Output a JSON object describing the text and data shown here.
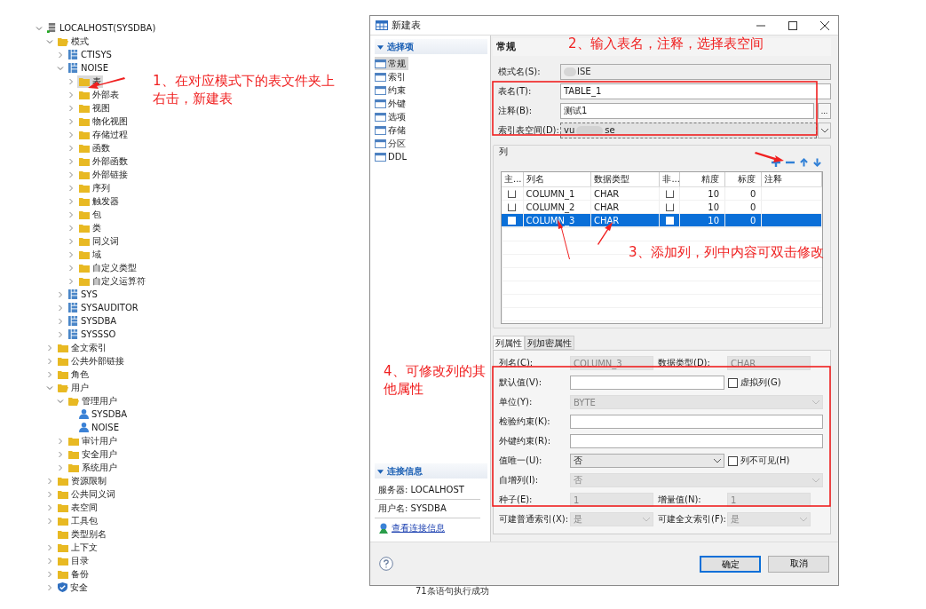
{
  "tree": [
    {
      "label": "LOCALHOST(SYSDBA)",
      "kind": "server",
      "toggle": true,
      "expanded": true,
      "selected": false,
      "children": [
        {
          "label": "模式",
          "kind": "folder",
          "toggle": true,
          "expanded": true,
          "selected": false,
          "children": [
            {
              "label": "CTISYS",
              "kind": "schema",
              "toggle": true,
              "expanded": false,
              "selected": false
            },
            {
              "label": "NOISE",
              "kind": "schema",
              "toggle": true,
              "expanded": true,
              "selected": false,
              "children": [
                {
                  "label": "表",
                  "kind": "folder",
                  "toggle": true,
                  "expanded": false,
                  "selected": true
                },
                {
                  "label": "外部表",
                  "kind": "folder",
                  "toggle": true,
                  "expanded": false,
                  "selected": false
                },
                {
                  "label": "视图",
                  "kind": "folder",
                  "toggle": true,
                  "expanded": false,
                  "selected": false
                },
                {
                  "label": "物化视图",
                  "kind": "folder",
                  "toggle": true,
                  "expanded": false,
                  "selected": false
                },
                {
                  "label": "存储过程",
                  "kind": "folder",
                  "toggle": true,
                  "expanded": false,
                  "selected": false
                },
                {
                  "label": "函数",
                  "kind": "folder",
                  "toggle": true,
                  "expanded": false,
                  "selected": false
                },
                {
                  "label": "外部函数",
                  "kind": "folder",
                  "toggle": true,
                  "expanded": false,
                  "selected": false
                },
                {
                  "label": "外部链接",
                  "kind": "folder",
                  "toggle": true,
                  "expanded": false,
                  "selected": false
                },
                {
                  "label": "序列",
                  "kind": "folder",
                  "toggle": true,
                  "expanded": false,
                  "selected": false
                },
                {
                  "label": "触发器",
                  "kind": "folder",
                  "toggle": true,
                  "expanded": false,
                  "selected": false
                },
                {
                  "label": "包",
                  "kind": "folder",
                  "toggle": true,
                  "expanded": false,
                  "selected": false
                },
                {
                  "label": "类",
                  "kind": "folder",
                  "toggle": true,
                  "expanded": false,
                  "selected": false
                },
                {
                  "label": "同义词",
                  "kind": "folder",
                  "toggle": true,
                  "expanded": false,
                  "selected": false
                },
                {
                  "label": "域",
                  "kind": "folder",
                  "toggle": true,
                  "expanded": false,
                  "selected": false
                },
                {
                  "label": "自定义类型",
                  "kind": "folder",
                  "toggle": true,
                  "expanded": false,
                  "selected": false
                },
                {
                  "label": "自定义运算符",
                  "kind": "folder",
                  "toggle": true,
                  "expanded": false,
                  "selected": false
                }
              ]
            },
            {
              "label": "SYS",
              "kind": "schema",
              "toggle": true,
              "expanded": false,
              "selected": false
            },
            {
              "label": "SYSAUDITOR",
              "kind": "schema",
              "toggle": true,
              "expanded": false,
              "selected": false
            },
            {
              "label": "SYSDBA",
              "kind": "schema",
              "toggle": true,
              "expanded": false,
              "selected": false
            },
            {
              "label": "SYSSSO",
              "kind": "schema",
              "toggle": true,
              "expanded": false,
              "selected": false
            }
          ]
        },
        {
          "label": "全文索引",
          "kind": "folder",
          "toggle": true,
          "expanded": false,
          "selected": false
        },
        {
          "label": "公共外部链接",
          "kind": "folder",
          "toggle": true,
          "expanded": false,
          "selected": false
        },
        {
          "label": "角色",
          "kind": "folder",
          "toggle": true,
          "expanded": false,
          "selected": false
        },
        {
          "label": "用户",
          "kind": "folder",
          "toggle": true,
          "expanded": true,
          "selected": false,
          "children": [
            {
              "label": "管理用户",
              "kind": "folder",
              "toggle": true,
              "expanded": true,
              "selected": false,
              "children": [
                {
                  "label": "SYSDBA",
                  "kind": "user",
                  "toggle": false,
                  "selected": false
                },
                {
                  "label": "NOISE",
                  "kind": "user",
                  "toggle": false,
                  "selected": false
                }
              ]
            },
            {
              "label": "审计用户",
              "kind": "folder",
              "toggle": true,
              "expanded": false,
              "selected": false
            },
            {
              "label": "安全用户",
              "kind": "folder",
              "toggle": true,
              "expanded": false,
              "selected": false
            },
            {
              "label": "系统用户",
              "kind": "folder",
              "toggle": true,
              "expanded": false,
              "selected": false
            }
          ]
        },
        {
          "label": "资源限制",
          "kind": "folder",
          "toggle": true,
          "expanded": false,
          "selected": false
        },
        {
          "label": "公共同义词",
          "kind": "folder",
          "toggle": true,
          "expanded": false,
          "selected": false
        },
        {
          "label": "表空间",
          "kind": "folder",
          "toggle": true,
          "expanded": false,
          "selected": false
        },
        {
          "label": "工具包",
          "kind": "folder",
          "toggle": true,
          "expanded": false,
          "selected": false
        },
        {
          "label": "类型别名",
          "kind": "folder",
          "toggle": false,
          "expanded": false,
          "selected": false
        },
        {
          "label": "上下文",
          "kind": "folder",
          "toggle": true,
          "expanded": false,
          "selected": false
        },
        {
          "label": "目录",
          "kind": "folder",
          "toggle": true,
          "expanded": false,
          "selected": false
        },
        {
          "label": "备份",
          "kind": "folder",
          "toggle": true,
          "expanded": false,
          "selected": false
        },
        {
          "label": "安全",
          "kind": "security",
          "toggle": true,
          "expanded": false,
          "selected": false
        }
      ]
    }
  ],
  "background_message": "71条语句执行成功",
  "dialog": {
    "title": "新建表",
    "nav": {
      "header": "选择项",
      "items": [
        {
          "label": "常规",
          "selected": true
        },
        {
          "label": "索引",
          "selected": false
        },
        {
          "label": "约束",
          "selected": false
        },
        {
          "label": "外键",
          "selected": false
        },
        {
          "label": "选项",
          "selected": false
        },
        {
          "label": "存储",
          "selected": false
        },
        {
          "label": "分区",
          "selected": false
        },
        {
          "label": "DDL",
          "selected": false
        }
      ]
    },
    "connection": {
      "header": "连接信息",
      "lines": [
        "服务器: LOCALHOST",
        "用户名: SYSDBA"
      ],
      "link": "查看连接信息"
    },
    "section_title": "常规",
    "form": [
      {
        "label": "模式名(S):",
        "value": "ISE",
        "kind": "readonly"
      },
      {
        "label": "表名(T):",
        "value": "TABLE_1",
        "kind": "text"
      },
      {
        "label": "注释(B):",
        "value": "测试1",
        "kind": "browse",
        "button": "..."
      },
      {
        "label": "索引表空间(D):",
        "value": "vu",
        "value_end": "se",
        "kind": "select"
      }
    ],
    "columns_group": {
      "title": "列",
      "table": {
        "columns": [
          "主...",
          "列名",
          "数据类型",
          "非...",
          "精度",
          "标度",
          "注释"
        ],
        "rows": [
          {
            "primary": false,
            "name": "COLUMN_1",
            "type": "CHAR",
            "not_null": false,
            "precision": "10",
            "scale": "0",
            "selected": false
          },
          {
            "primary": false,
            "name": "COLUMN_2",
            "type": "CHAR",
            "not_null": false,
            "precision": "10",
            "scale": "0",
            "selected": false
          },
          {
            "primary": false,
            "name": "COLUMN_3",
            "type": "CHAR",
            "not_null": false,
            "precision": "10",
            "scale": "0",
            "selected": true
          }
        ]
      }
    },
    "property_tabs": [
      {
        "label": "列属性",
        "selected": true
      },
      {
        "label": "列加密属性",
        "selected": false
      }
    ],
    "properties": [
      {
        "kind": "pair",
        "fields": [
          {
            "label": "列名(C):",
            "value": "COLUMN_3",
            "kind": "text",
            "disabled": true
          },
          {
            "label": "数据类型(D):",
            "value": "CHAR",
            "kind": "text",
            "disabled": true
          }
        ]
      },
      {
        "kind": "single",
        "fields": [
          {
            "label": "默认值(V):",
            "kind": "text",
            "disabled": false
          }
        ],
        "checkbox": {
          "label": "虚拟列(G)",
          "checked": false
        }
      },
      {
        "kind": "single",
        "fields": [
          {
            "label": "单位(Y):",
            "value": "BYTE",
            "kind": "select",
            "disabled": true
          }
        ]
      },
      {
        "kind": "single",
        "fields": [
          {
            "label": "检验约束(K):",
            "kind": "text",
            "disabled": false
          }
        ]
      },
      {
        "kind": "single",
        "fields": [
          {
            "label": "外键约束(R):",
            "kind": "text",
            "disabled": false
          }
        ]
      },
      {
        "kind": "single",
        "fields": [
          {
            "label": "值唯一(U):",
            "value": "否",
            "kind": "select",
            "disabled": false
          }
        ],
        "checkbox": {
          "label": "列不可见(H)",
          "checked": false
        }
      },
      {
        "kind": "single",
        "fields": [
          {
            "label": "自增列(I):",
            "value": "否",
            "kind": "select",
            "disabled": true
          }
        ]
      },
      {
        "kind": "pair",
        "fields": [
          {
            "label": "种子(E):",
            "value": "1",
            "kind": "text",
            "disabled": true
          },
          {
            "label": "增量值(N):",
            "value": "1",
            "kind": "text",
            "disabled": true
          }
        ]
      },
      {
        "kind": "pair",
        "fields": [
          {
            "label": "可建普通索引(X):",
            "value": "是",
            "kind": "select",
            "disabled": true
          },
          {
            "label": "可建全文索引(F):",
            "value": "是",
            "kind": "select",
            "disabled": true
          }
        ]
      }
    ],
    "buttons": [
      {
        "label": "确定",
        "default": true
      },
      {
        "label": "取消",
        "default": false
      }
    ]
  },
  "annotations": [
    "1、在对应模式下的表文件夹上右击，新建表",
    "2、输入表名，注释，选择表空间",
    "3、添加列，列中内容可双击修改",
    "4、可修改列的其他属性"
  ]
}
